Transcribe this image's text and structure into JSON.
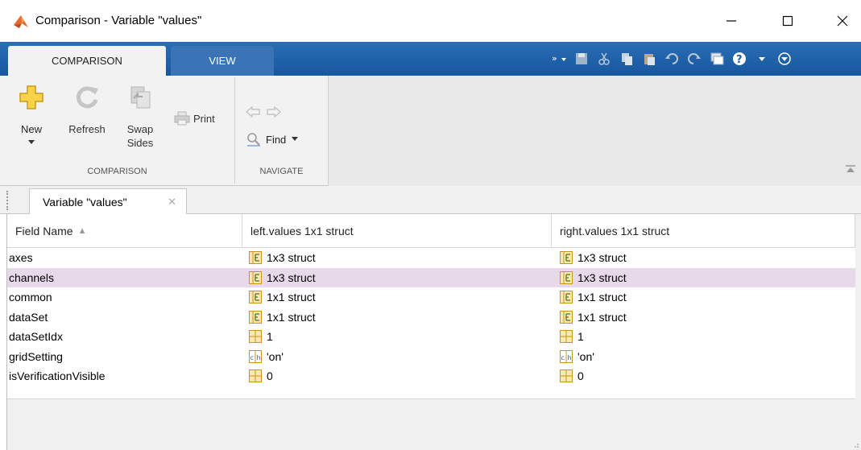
{
  "window": {
    "title": "Comparison - Variable \"values\"",
    "controls": {
      "minimize": "—",
      "maximize": "☐",
      "close": "✕"
    }
  },
  "ribbon": {
    "tabs": [
      {
        "label": "COMPARISON",
        "active": true
      },
      {
        "label": "VIEW",
        "active": false
      }
    ],
    "groups": {
      "comparison": {
        "label": "COMPARISON",
        "tools": {
          "new": "New",
          "refresh": "Refresh",
          "swap_line1": "Swap",
          "swap_line2": "Sides",
          "print": "Print"
        }
      },
      "navigate": {
        "label": "NAVIGATE",
        "tools": {
          "find": "Find"
        }
      }
    },
    "quick_access_icons": [
      "toolstrip-overflow-icon",
      "save-icon",
      "cut-icon",
      "copy-icon",
      "paste-icon",
      "undo-icon",
      "redo-icon",
      "switch-windows-icon",
      "help-icon",
      "options-icon"
    ]
  },
  "document_tab": {
    "label": "Variable \"values\"",
    "close": "✕"
  },
  "table": {
    "headers": [
      "Field Name",
      "left.values 1x1 struct",
      "right.values 1x1 struct"
    ],
    "sort_indicator": "▲",
    "rows": [
      {
        "name": "axes",
        "left": "1x3 struct",
        "right": "1x3 struct",
        "icon": "struct",
        "selected": false
      },
      {
        "name": "channels",
        "left": "1x3 struct",
        "right": "1x3 struct",
        "icon": "struct",
        "selected": true
      },
      {
        "name": "common",
        "left": "1x1 struct",
        "right": "1x1 struct",
        "icon": "struct",
        "selected": false
      },
      {
        "name": "dataSet",
        "left": "1x1 struct",
        "right": "1x1 struct",
        "icon": "struct",
        "selected": false
      },
      {
        "name": "dataSetIdx",
        "left": "1",
        "right": "1",
        "icon": "numeric",
        "selected": false
      },
      {
        "name": "gridSetting",
        "left": "'on'",
        "right": "'on'",
        "icon": "char",
        "selected": false
      },
      {
        "name": "isVerificationVisible",
        "left": "0",
        "right": "0",
        "icon": "numeric",
        "selected": false
      }
    ]
  },
  "colors": {
    "tabstrip": "#1f5fa5",
    "selected_row": "#e8d9ea",
    "struct_icon": "#d9a21c"
  }
}
